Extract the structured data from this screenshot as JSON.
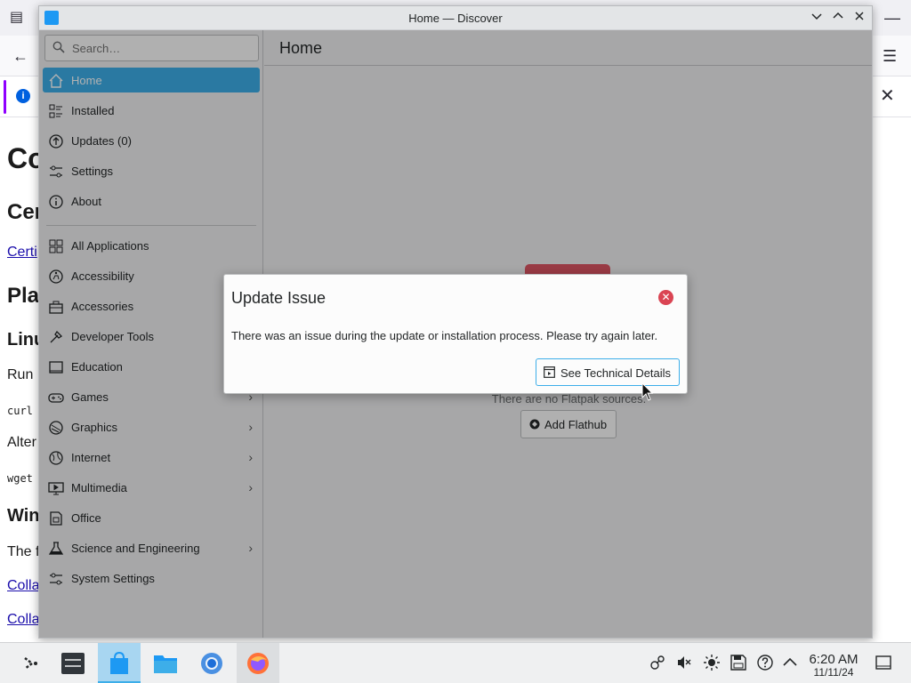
{
  "browser": {
    "page": {
      "h1": "Co",
      "h2a": "Cer",
      "link1": "Certi",
      "h2b": "Pla",
      "h3a": "Linu",
      "p1": "Run",
      "code1": "curl",
      "p2": "Alter",
      "code2": "wget",
      "h3b": "Win",
      "p3": "The f",
      "link2": "Colla",
      "link3": "Colla"
    }
  },
  "window": {
    "title": "Home — Discover"
  },
  "sidebar": {
    "search_placeholder": "Search…",
    "items": [
      {
        "label": "Home",
        "icon": "home-icon",
        "selected": true
      },
      {
        "label": "Installed",
        "icon": "installed-icon"
      },
      {
        "label": "Updates (0)",
        "icon": "updates-icon"
      },
      {
        "label": "Settings",
        "icon": "settings-icon"
      },
      {
        "label": "About",
        "icon": "about-icon"
      }
    ],
    "categories": [
      {
        "label": "All Applications",
        "icon": "grid-icon",
        "chevron": false
      },
      {
        "label": "Accessibility",
        "icon": "accessibility-icon",
        "chevron": false
      },
      {
        "label": "Accessories",
        "icon": "accessories-icon",
        "chevron": false
      },
      {
        "label": "Developer Tools",
        "icon": "developer-tools-icon",
        "chevron": false
      },
      {
        "label": "Education",
        "icon": "education-icon",
        "chevron": false
      },
      {
        "label": "Games",
        "icon": "games-icon",
        "chevron": true
      },
      {
        "label": "Graphics",
        "icon": "graphics-icon",
        "chevron": true
      },
      {
        "label": "Internet",
        "icon": "internet-icon",
        "chevron": true
      },
      {
        "label": "Multimedia",
        "icon": "multimedia-icon",
        "chevron": true
      },
      {
        "label": "Office",
        "icon": "office-icon",
        "chevron": false
      },
      {
        "label": "Science and Engineering",
        "icon": "science-icon",
        "chevron": true
      },
      {
        "label": "System Settings",
        "icon": "system-settings-icon",
        "chevron": false
      }
    ]
  },
  "main": {
    "title": "Home",
    "no_sources_text": "There are no Flatpak sources.",
    "add_flathub_label": "Add Flathub"
  },
  "dialog": {
    "title": "Update Issue",
    "message": "There was an issue during the update or installation process. Please try again later.",
    "button_label": "See Technical Details"
  },
  "taskbar": {
    "time": "6:20 AM",
    "date": "11/11/24"
  },
  "colors": {
    "accent": "#3daee9",
    "close_red": "#da4453"
  }
}
